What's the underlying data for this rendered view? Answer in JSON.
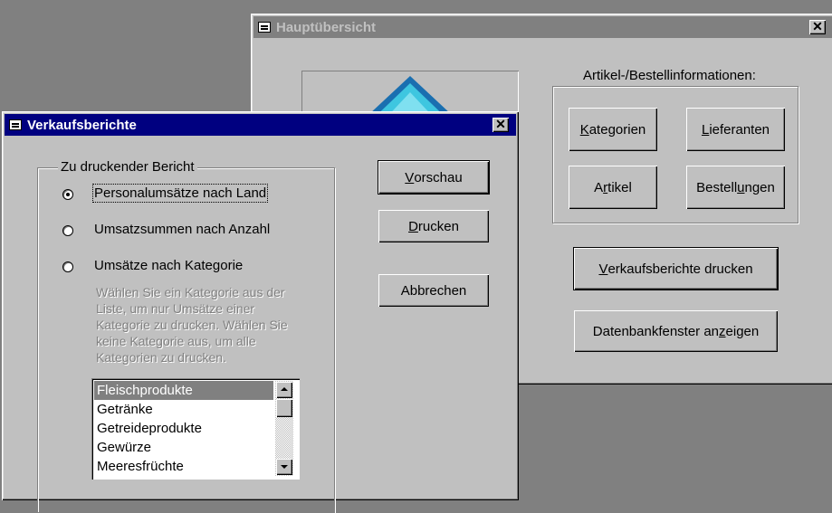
{
  "main_window": {
    "title": "Hauptübersicht",
    "group_label": "Artikel-/Bestellinformationen:",
    "buttons": {
      "kategorien": {
        "pre": "",
        "key": "K",
        "post": "ategorien"
      },
      "lieferanten": {
        "pre": "",
        "key": "L",
        "post": "ieferanten"
      },
      "artikel": {
        "pre": "A",
        "key": "r",
        "post": "tikel"
      },
      "bestellungen": {
        "pre": "Bestell",
        "key": "u",
        "post": "ngen"
      },
      "verkaufsberichte": {
        "pre": "",
        "key": "V",
        "post": "erkaufsberichte drucken"
      },
      "datenbankfenster": {
        "pre": "Datenbankfenster an",
        "key": "z",
        "post": "eigen"
      }
    }
  },
  "dialog": {
    "title": "Verkaufsberichte",
    "group_title": "Zu druckender Bericht",
    "options": [
      {
        "label": "Personalumsätze nach Land",
        "checked": true
      },
      {
        "label": "Umsatzsummen nach Anzahl",
        "checked": false
      },
      {
        "label": "Umsätze nach Kategorie",
        "checked": false
      }
    ],
    "hint_lines": [
      "Wählen Sie ein Kategorie aus der",
      "Liste, um nur Umsätze einer",
      "Kategorie zu drucken. Wählen Sie",
      "keine Kategorie aus, um alle",
      "Kategorien zu drucken."
    ],
    "categories": [
      "Fleischprodukte",
      "Getränke",
      "Getreideprodukte",
      "Gewürze",
      "Meeresfrüchte"
    ],
    "selected_category_index": 0,
    "buttons": {
      "vorschau": {
        "pre": "",
        "key": "V",
        "post": "orschau"
      },
      "drucken": {
        "pre": "",
        "key": "D",
        "post": "rucken"
      },
      "abbrechen": {
        "pre": "Abbrechen",
        "key": "",
        "post": ""
      }
    }
  },
  "colors": {
    "title_active": "#000080",
    "title_inactive": "#808080",
    "face": "#c0c0c0",
    "desktop": "#808080"
  }
}
